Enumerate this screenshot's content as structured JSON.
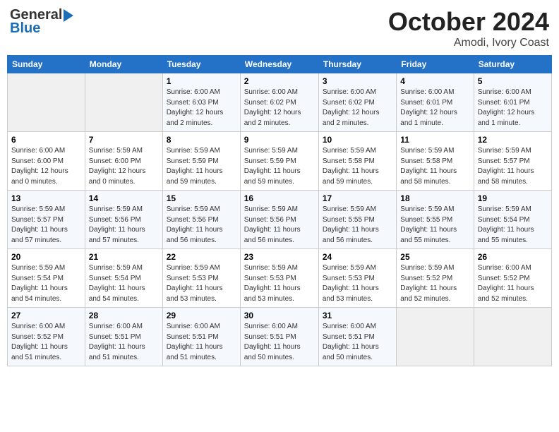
{
  "header": {
    "logo_general": "General",
    "logo_blue": "Blue",
    "month_title": "October 2024",
    "location": "Amodi, Ivory Coast"
  },
  "columns": [
    "Sunday",
    "Monday",
    "Tuesday",
    "Wednesday",
    "Thursday",
    "Friday",
    "Saturday"
  ],
  "weeks": [
    [
      {
        "day": "",
        "info": ""
      },
      {
        "day": "",
        "info": ""
      },
      {
        "day": "1",
        "info": "Sunrise: 6:00 AM\nSunset: 6:03 PM\nDaylight: 12 hours\nand 2 minutes."
      },
      {
        "day": "2",
        "info": "Sunrise: 6:00 AM\nSunset: 6:02 PM\nDaylight: 12 hours\nand 2 minutes."
      },
      {
        "day": "3",
        "info": "Sunrise: 6:00 AM\nSunset: 6:02 PM\nDaylight: 12 hours\nand 2 minutes."
      },
      {
        "day": "4",
        "info": "Sunrise: 6:00 AM\nSunset: 6:01 PM\nDaylight: 12 hours\nand 1 minute."
      },
      {
        "day": "5",
        "info": "Sunrise: 6:00 AM\nSunset: 6:01 PM\nDaylight: 12 hours\nand 1 minute."
      }
    ],
    [
      {
        "day": "6",
        "info": "Sunrise: 6:00 AM\nSunset: 6:00 PM\nDaylight: 12 hours\nand 0 minutes."
      },
      {
        "day": "7",
        "info": "Sunrise: 5:59 AM\nSunset: 6:00 PM\nDaylight: 12 hours\nand 0 minutes."
      },
      {
        "day": "8",
        "info": "Sunrise: 5:59 AM\nSunset: 5:59 PM\nDaylight: 11 hours\nand 59 minutes."
      },
      {
        "day": "9",
        "info": "Sunrise: 5:59 AM\nSunset: 5:59 PM\nDaylight: 11 hours\nand 59 minutes."
      },
      {
        "day": "10",
        "info": "Sunrise: 5:59 AM\nSunset: 5:58 PM\nDaylight: 11 hours\nand 59 minutes."
      },
      {
        "day": "11",
        "info": "Sunrise: 5:59 AM\nSunset: 5:58 PM\nDaylight: 11 hours\nand 58 minutes."
      },
      {
        "day": "12",
        "info": "Sunrise: 5:59 AM\nSunset: 5:57 PM\nDaylight: 11 hours\nand 58 minutes."
      }
    ],
    [
      {
        "day": "13",
        "info": "Sunrise: 5:59 AM\nSunset: 5:57 PM\nDaylight: 11 hours\nand 57 minutes."
      },
      {
        "day": "14",
        "info": "Sunrise: 5:59 AM\nSunset: 5:56 PM\nDaylight: 11 hours\nand 57 minutes."
      },
      {
        "day": "15",
        "info": "Sunrise: 5:59 AM\nSunset: 5:56 PM\nDaylight: 11 hours\nand 56 minutes."
      },
      {
        "day": "16",
        "info": "Sunrise: 5:59 AM\nSunset: 5:56 PM\nDaylight: 11 hours\nand 56 minutes."
      },
      {
        "day": "17",
        "info": "Sunrise: 5:59 AM\nSunset: 5:55 PM\nDaylight: 11 hours\nand 56 minutes."
      },
      {
        "day": "18",
        "info": "Sunrise: 5:59 AM\nSunset: 5:55 PM\nDaylight: 11 hours\nand 55 minutes."
      },
      {
        "day": "19",
        "info": "Sunrise: 5:59 AM\nSunset: 5:54 PM\nDaylight: 11 hours\nand 55 minutes."
      }
    ],
    [
      {
        "day": "20",
        "info": "Sunrise: 5:59 AM\nSunset: 5:54 PM\nDaylight: 11 hours\nand 54 minutes."
      },
      {
        "day": "21",
        "info": "Sunrise: 5:59 AM\nSunset: 5:54 PM\nDaylight: 11 hours\nand 54 minutes."
      },
      {
        "day": "22",
        "info": "Sunrise: 5:59 AM\nSunset: 5:53 PM\nDaylight: 11 hours\nand 53 minutes."
      },
      {
        "day": "23",
        "info": "Sunrise: 5:59 AM\nSunset: 5:53 PM\nDaylight: 11 hours\nand 53 minutes."
      },
      {
        "day": "24",
        "info": "Sunrise: 5:59 AM\nSunset: 5:53 PM\nDaylight: 11 hours\nand 53 minutes."
      },
      {
        "day": "25",
        "info": "Sunrise: 5:59 AM\nSunset: 5:52 PM\nDaylight: 11 hours\nand 52 minutes."
      },
      {
        "day": "26",
        "info": "Sunrise: 6:00 AM\nSunset: 5:52 PM\nDaylight: 11 hours\nand 52 minutes."
      }
    ],
    [
      {
        "day": "27",
        "info": "Sunrise: 6:00 AM\nSunset: 5:52 PM\nDaylight: 11 hours\nand 51 minutes."
      },
      {
        "day": "28",
        "info": "Sunrise: 6:00 AM\nSunset: 5:51 PM\nDaylight: 11 hours\nand 51 minutes."
      },
      {
        "day": "29",
        "info": "Sunrise: 6:00 AM\nSunset: 5:51 PM\nDaylight: 11 hours\nand 51 minutes."
      },
      {
        "day": "30",
        "info": "Sunrise: 6:00 AM\nSunset: 5:51 PM\nDaylight: 11 hours\nand 50 minutes."
      },
      {
        "day": "31",
        "info": "Sunrise: 6:00 AM\nSunset: 5:51 PM\nDaylight: 11 hours\nand 50 minutes."
      },
      {
        "day": "",
        "info": ""
      },
      {
        "day": "",
        "info": ""
      }
    ]
  ]
}
